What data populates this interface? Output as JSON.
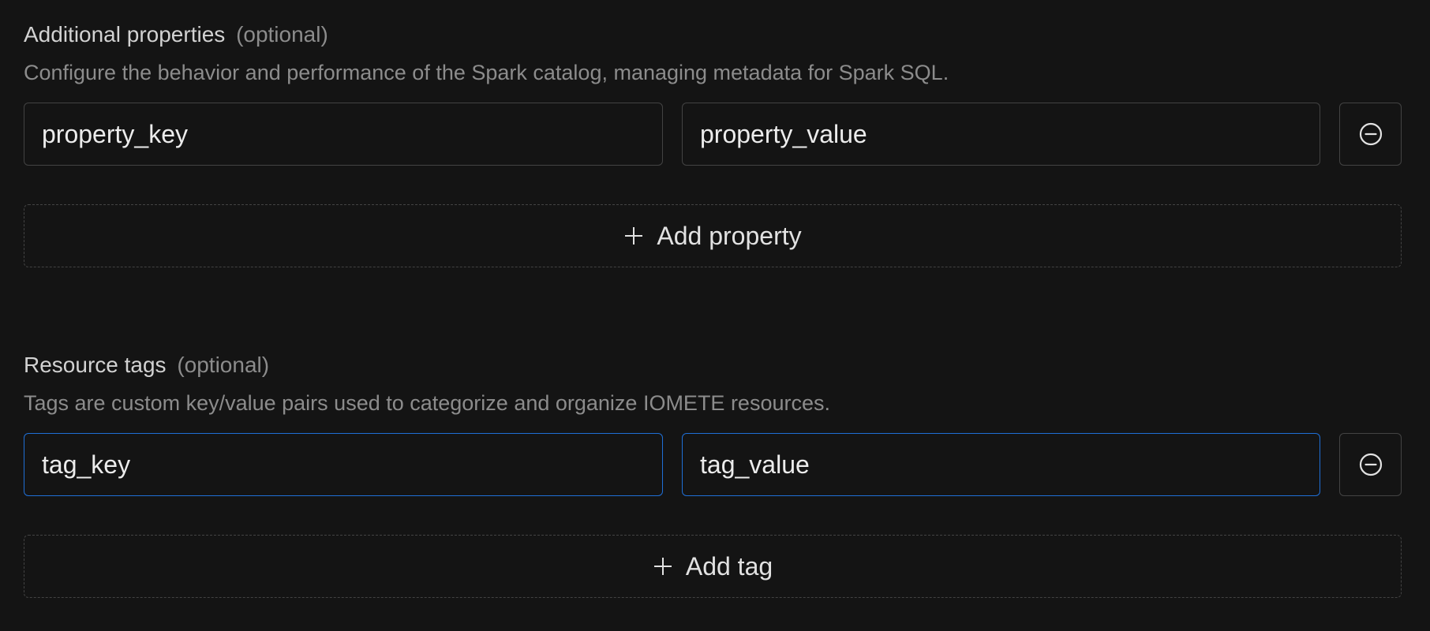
{
  "properties_section": {
    "title": "Additional properties",
    "optional": "(optional)",
    "description": "Configure the behavior and performance of the Spark catalog, managing metadata for Spark SQL.",
    "key_value": "property_key",
    "value_value": "property_value",
    "remove_icon": "minus-circle-icon",
    "add_label": "Add property",
    "add_icon": "plus-icon"
  },
  "tags_section": {
    "title": "Resource tags",
    "optional": "(optional)",
    "description": "Tags are custom key/value pairs used to categorize and organize IOMETE resources.",
    "key_value": "tag_key",
    "value_value": "tag_value",
    "remove_icon": "minus-circle-icon",
    "add_label": "Add tag",
    "add_icon": "plus-icon"
  },
  "colors": {
    "background": "#141414",
    "border": "#434343",
    "focus_border": "#1f6fd6",
    "text": "#ececec",
    "muted_text": "#8c8c8c"
  }
}
